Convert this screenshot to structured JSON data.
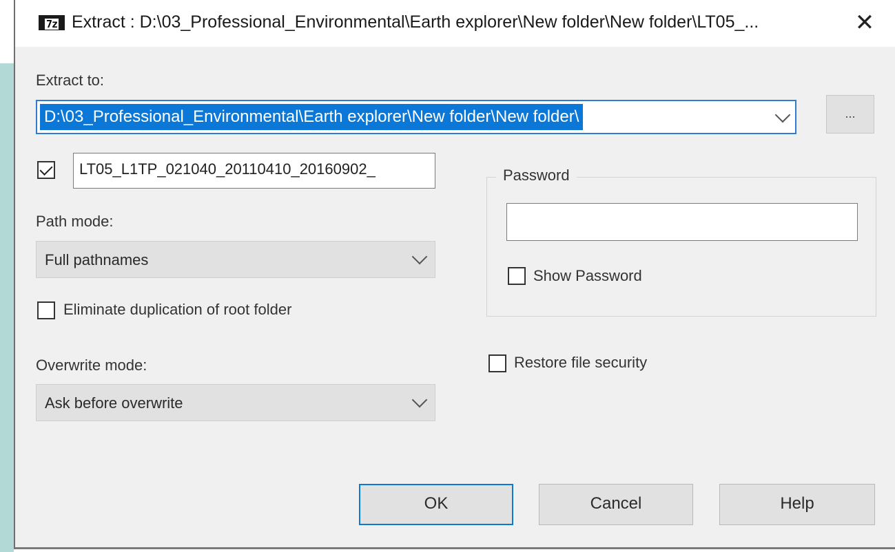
{
  "window": {
    "title": "Extract : D:\\03_Professional_Environmental\\Earth explorer\\New folder\\New folder\\LT05_...",
    "app_icon_text": "7z",
    "close_glyph": "✕"
  },
  "extract_to": {
    "label": "Extract to:",
    "value": "D:\\03_Professional_Environmental\\Earth explorer\\New folder\\New folder\\",
    "browse_label": "..."
  },
  "subfolder": {
    "checked": true,
    "value": "LT05_L1TP_021040_20110410_20160902_"
  },
  "path_mode": {
    "label": "Path mode:",
    "selected": "Full pathnames"
  },
  "eliminate_duplication": {
    "label": "Eliminate duplication of root folder",
    "checked": false
  },
  "overwrite_mode": {
    "label": "Overwrite mode:",
    "selected": "Ask before overwrite"
  },
  "password": {
    "group_label": "Password",
    "value": "",
    "show_password_label": "Show Password",
    "show_password_checked": false
  },
  "restore_security": {
    "label": "Restore file security",
    "checked": false
  },
  "buttons": {
    "ok": "OK",
    "cancel": "Cancel",
    "help": "Help"
  },
  "colors": {
    "accent": "#0b78d7",
    "dialog_bg": "#f0f0f0"
  }
}
